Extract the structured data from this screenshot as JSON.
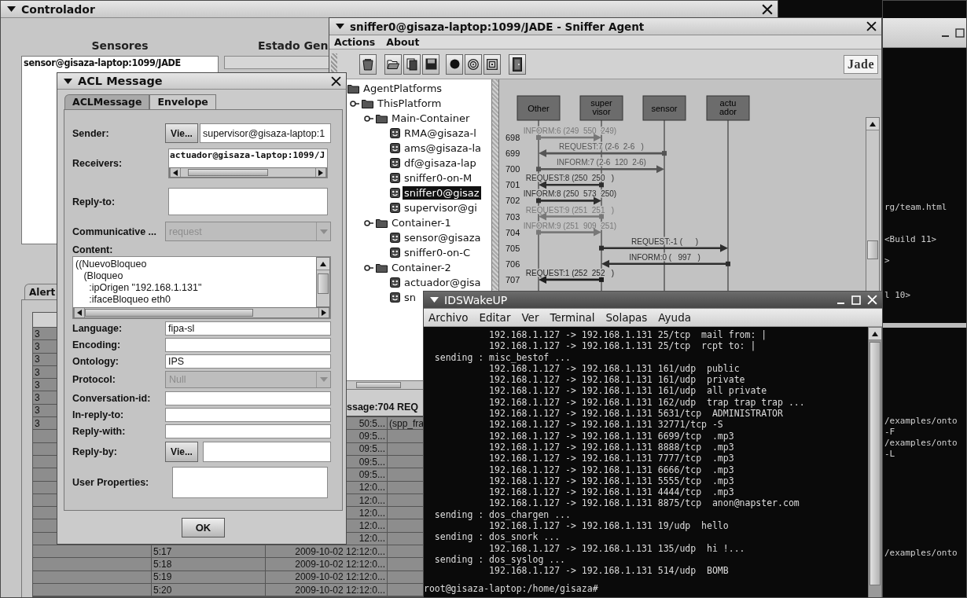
{
  "controller": {
    "title": "Controlador",
    "sensors_heading": "Sensores",
    "status_heading": "Estado Gen",
    "sensors": [
      "sensor@gisaza-laptop:1099/JADE"
    ],
    "tabs": [
      {
        "label": "Alert",
        "selected": true
      }
    ],
    "table": {
      "rows": [
        {
          "column_1": "3"
        },
        {
          "column_1": "3"
        },
        {
          "column_1": "3"
        },
        {
          "column_1": "3"
        },
        {
          "column_1": "3"
        },
        {
          "column_1": "3"
        },
        {
          "column_1": "3"
        },
        {
          "column_1": "3",
          "column_3": "50:5...",
          "column_4": "(spp_fra"
        },
        {
          "column_3": "09:5..."
        },
        {
          "column_3": "09:5..."
        },
        {
          "column_3": "09:5..."
        },
        {
          "column_3": "09:5..."
        },
        {
          "column_3": "12:0..."
        },
        {
          "column_3": "12:0..."
        },
        {
          "column_3": "12:0..."
        },
        {
          "column_3": "12:0..."
        },
        {
          "column_3": "12:0..."
        },
        {
          "column_2": "5:17",
          "column_3": "2009-10-02 12:12:0..."
        },
        {
          "column_2": "5:18",
          "column_3": "2009-10-02 12:12:0..."
        },
        {
          "column_2": "5:19",
          "column_3": "2009-10-02 12:12:0..."
        },
        {
          "column_2": "5:20",
          "column_3": "2009-10-02 12:12:0..."
        }
      ]
    }
  },
  "acl_dialog": {
    "title": "ACL Message",
    "tabs": [
      {
        "label": "ACLMessage",
        "selected": true
      },
      {
        "label": "Envelope",
        "selected": false
      }
    ],
    "sender": {
      "label": "Sender:",
      "button": "Vie...",
      "value": "supervisor@gisaza-laptop:1"
    },
    "receivers": {
      "label": "Receivers:",
      "items": [
        "actuador@gisaza-laptop:1099/J"
      ]
    },
    "reply_to": {
      "label": "Reply-to:"
    },
    "performative": {
      "label": "Communicative ...",
      "value": "request",
      "disabled": true
    },
    "content": {
      "label": "Content:",
      "lines": [
        "((NuevoBloqueo",
        "   (Bloqueo",
        "     :ipOrigen \"192.168.1.131\"",
        "     :ifaceBloqueo eth0"
      ]
    },
    "fields": [
      {
        "label": "Language:",
        "kind": "text",
        "value": "fipa-sl"
      },
      {
        "label": "Encoding:",
        "kind": "text"
      },
      {
        "label": "Ontology:",
        "kind": "text",
        "value": "IPS"
      },
      {
        "label": "Protocol:",
        "kind": "combo",
        "value": "Null",
        "disabled": true
      },
      {
        "label": "Conversation-id:",
        "kind": "text"
      },
      {
        "label": "In-reply-to:",
        "kind": "text"
      },
      {
        "label": "Reply-with:",
        "kind": "text"
      },
      {
        "label": "Reply-by:",
        "kind": "date",
        "button": "Vie..."
      },
      {
        "label": "User Properties:",
        "kind": "area"
      }
    ],
    "ok_button": "OK"
  },
  "sniffer": {
    "title": "sniffer0@gisaza-laptop:1099/JADE - Sniffer Agent",
    "menu": [
      "Actions",
      "About"
    ],
    "logo": "Jade",
    "tree": [
      {
        "label": "AgentPlatforms",
        "kind": "folder",
        "selected": false,
        "children": [
          {
            "label": "ThisPlatform",
            "kind": "folder",
            "selected": false,
            "expanded": true,
            "children": [
              {
                "label": "Main-Container",
                "kind": "folder",
                "selected": false,
                "expanded": true,
                "children": [
                  {
                    "label": "RMA@gisaza-l",
                    "kind": "agent",
                    "selected": false
                  },
                  {
                    "label": "ams@gisaza-la",
                    "kind": "agent",
                    "selected": false
                  },
                  {
                    "label": "df@gisaza-lap",
                    "kind": "agent",
                    "selected": false
                  },
                  {
                    "label": "sniffer0-on-M",
                    "kind": "agent",
                    "selected": false
                  },
                  {
                    "label": "sniffer0@gisaz",
                    "kind": "agent",
                    "selected": true
                  },
                  {
                    "label": "supervisor@gi",
                    "kind": "agent",
                    "selected": false
                  }
                ]
              },
              {
                "label": "Container-1",
                "kind": "folder",
                "selected": false,
                "expanded": true,
                "children": [
                  {
                    "label": "sensor@gisaza",
                    "kind": "agent",
                    "selected": false
                  },
                  {
                    "label": "sniffer0-on-C",
                    "kind": "agent",
                    "selected": false
                  }
                ]
              },
              {
                "label": "Container-2",
                "kind": "folder",
                "selected": false,
                "expanded": true,
                "children": [
                  {
                    "label": "actuador@gisa",
                    "kind": "agent",
                    "selected": false
                  },
                  {
                    "label": "sn",
                    "kind": "agent",
                    "selected": false
                  }
                ]
              }
            ]
          }
        ]
      }
    ],
    "agents": [
      {
        "lines": [
          "Other"
        ]
      },
      {
        "lines": [
          "super",
          "visor"
        ]
      },
      {
        "lines": [
          "sensor"
        ]
      },
      {
        "lines": [
          "actu",
          "ador"
        ]
      }
    ],
    "messages": [
      {
        "number": "698",
        "label": "INFORM:6 (249  550  249)",
        "color": "#787878"
      },
      {
        "number": "699",
        "label": "REQUEST:7 (2-6  2-6   )",
        "color": "#555555"
      },
      {
        "number": "700",
        "label": "INFORM:7 (2-6  120  2-6)",
        "color": "#555555"
      },
      {
        "number": "701",
        "label": "REQUEST:8 (250  250   )",
        "color": "#2e2e2e"
      },
      {
        "number": "702",
        "label": "INFORM:8 (250  573  250)",
        "color": "#2e2e2e"
      },
      {
        "number": "703",
        "label": "REQUEST:9 (251  251   )",
        "color": "#787878"
      },
      {
        "number": "704",
        "label": "INFORM:9 (251  909  251)",
        "color": "#787878"
      },
      {
        "number": "705",
        "label": "REQUEST:-1 (      )",
        "color": "#2e2e2e"
      },
      {
        "number": "706",
        "label": "INFORM:0 (   997   )",
        "color": "#2e2e2e"
      },
      {
        "number": "707",
        "label": "REQUEST:1 (252  252   )",
        "color": "#1e1e1e"
      }
    ],
    "status": "ssage:704 REQ"
  },
  "terminal": {
    "title": "IDSWakeUP",
    "menu": [
      "Archivo",
      "Editar",
      "Ver",
      "Terminal",
      "Solapas",
      "Ayuda"
    ],
    "lines": [
      "            192.168.1.127 -> 192.168.1.131 25/tcp  mail from: |",
      "            192.168.1.127 -> 192.168.1.131 25/tcp  rcpt to: |",
      "  sending : misc_bestof ...",
      "            192.168.1.127 -> 192.168.1.131 161/udp  public",
      "            192.168.1.127 -> 192.168.1.131 161/udp  private",
      "            192.168.1.127 -> 192.168.1.131 161/udp  all private",
      "            192.168.1.127 -> 192.168.1.131 162/udp  trap trap trap ...",
      "            192.168.1.127 -> 192.168.1.131 5631/tcp  ADMINISTRATOR",
      "            192.168.1.127 -> 192.168.1.131 32771/tcp -S",
      "            192.168.1.127 -> 192.168.1.131 6699/tcp  .mp3",
      "            192.168.1.127 -> 192.168.1.131 8888/tcp  .mp3",
      "            192.168.1.127 -> 192.168.1.131 7777/tcp  .mp3",
      "            192.168.1.127 -> 192.168.1.131 6666/tcp  .mp3",
      "            192.168.1.127 -> 192.168.1.131 5555/tcp  .mp3",
      "            192.168.1.127 -> 192.168.1.131 4444/tcp  .mp3",
      "            192.168.1.127 -> 192.168.1.131 8875/tcp  anon@napster.com",
      "  sending : dos_chargen ...",
      "            192.168.1.127 -> 192.168.1.131 19/udp  hello",
      "  sending : dos_snork ...",
      "            192.168.1.127 -> 192.168.1.131 135/udp  hi !...",
      "  sending : dos_syslog ...",
      "            192.168.1.127 -> 192.168.1.131 514/udp  BOMB"
    ],
    "prompt": "root@gisaza-laptop:/home/gisaza#"
  },
  "background_terminal": {
    "upper_lines": [
      "rg/team.html",
      "<Build 11>",
      ">",
      "l 10>"
    ],
    "lower_lines": [
      "/examples/onto",
      "-F",
      "/examples/onto",
      "-L",
      "/examples/onto"
    ]
  }
}
